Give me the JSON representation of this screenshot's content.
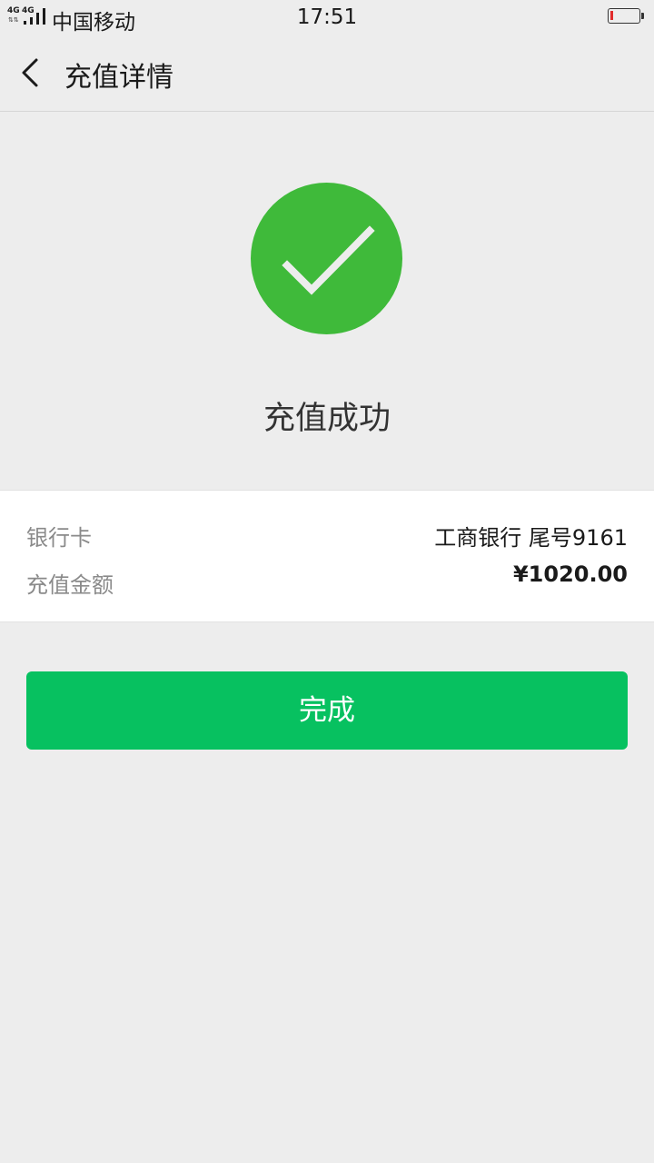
{
  "status_bar": {
    "network_1": "4G",
    "network_2": "4G",
    "carrier": "中国移动",
    "time": "17:51",
    "battery_level": 0.1,
    "battery_color": "#e12b2b"
  },
  "nav": {
    "back_icon": "chevron-left-icon",
    "title": "充值详情"
  },
  "result": {
    "icon": "checkmark-circle-icon",
    "icon_color": "#3fba3a",
    "text": "充值成功"
  },
  "details": {
    "bank_label": "银行卡",
    "bank_value": "工商银行 尾号9161",
    "amount_label": "充值金额",
    "amount_value": "¥1020.00"
  },
  "actions": {
    "done_label": "完成",
    "done_color": "#07c160"
  }
}
